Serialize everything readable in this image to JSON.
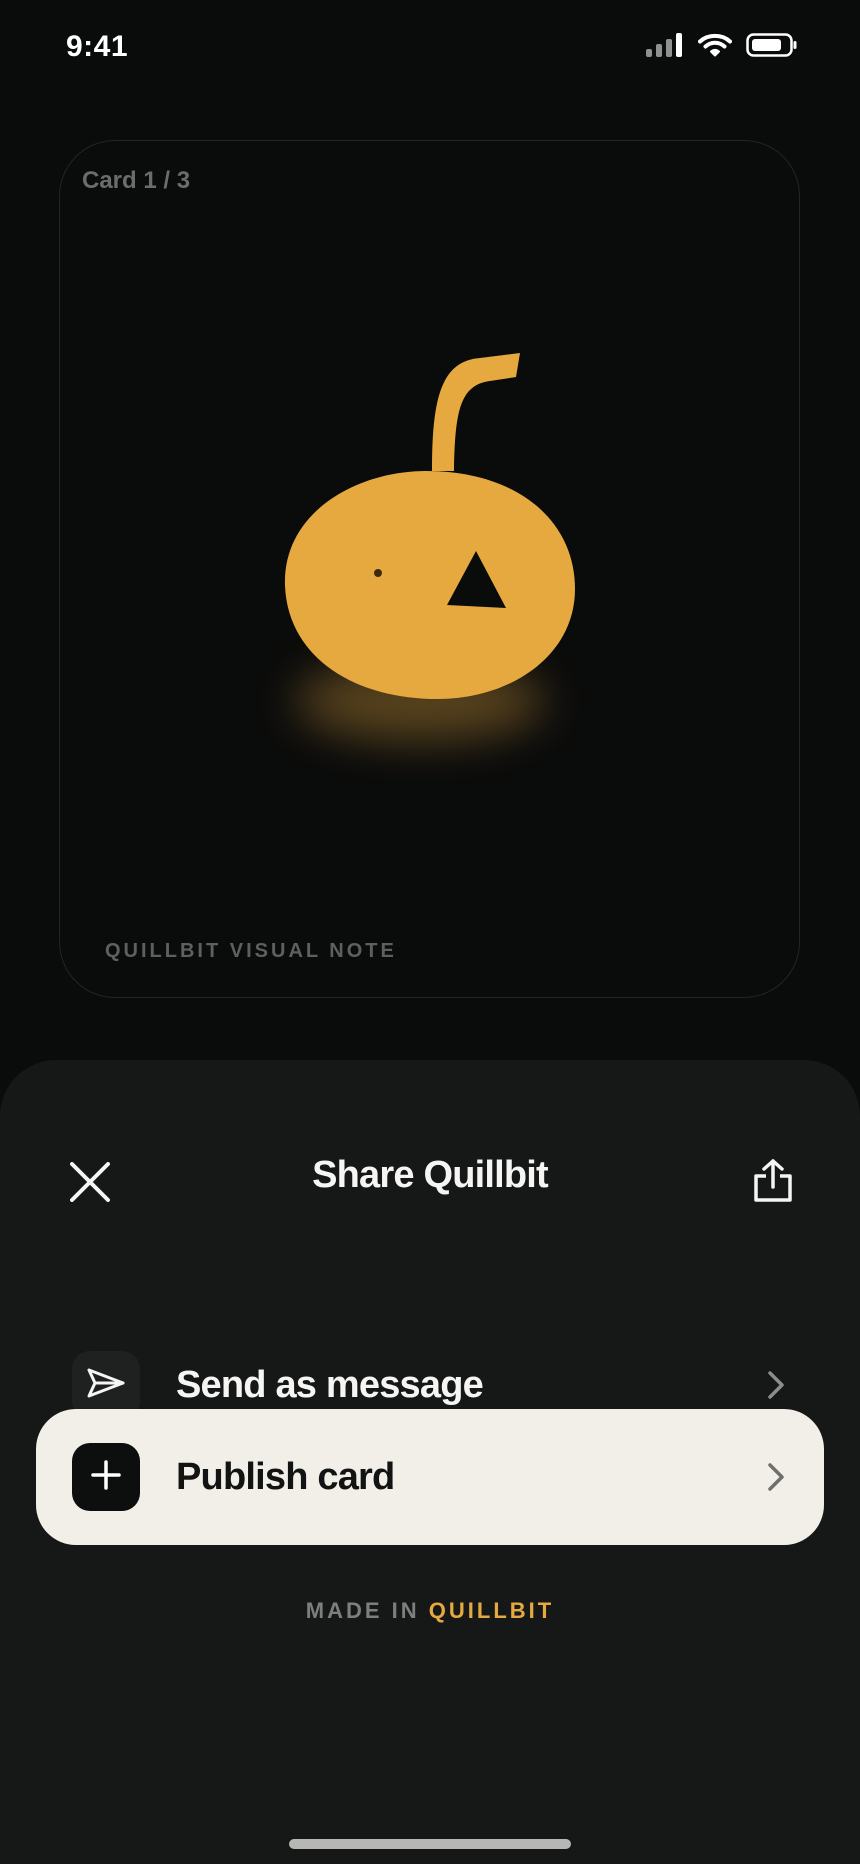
{
  "status_bar": {
    "time": "9:41"
  },
  "card": {
    "counter": "Card 1 / 3",
    "caption": "QUILLBIT VISUAL NOTE",
    "art_color": "#e6a940"
  },
  "sheet": {
    "title": "Share Quillbit",
    "options": [
      {
        "label": "Send as message",
        "icon": "paper-plane-icon"
      },
      {
        "label": "Publish card",
        "icon": "plus-icon"
      }
    ],
    "footer": {
      "prefix": "MADE IN",
      "brand": "QUILLBIT"
    }
  },
  "colors": {
    "background": "#0a0b0b",
    "sheet": "#161717",
    "accent": "#e6a940",
    "highlight_row": "#f1efe7"
  }
}
